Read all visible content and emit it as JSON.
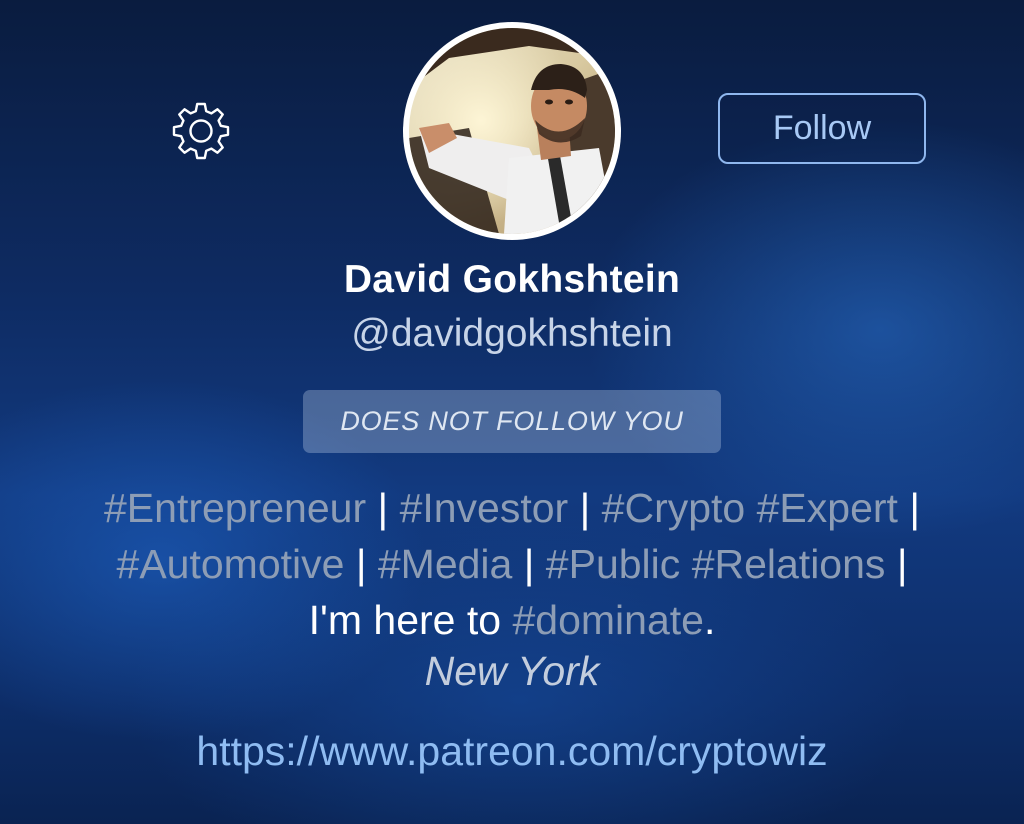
{
  "profile": {
    "name": "David Gokhshtein",
    "handle": "@davidgokhshtein",
    "relationship_badge": "DOES NOT FOLLOW YOU",
    "location": "New York",
    "website": "https://www.patreon.com/cryptowiz",
    "avatar_icon": "profile-photo"
  },
  "actions": {
    "follow_label": "Follow",
    "settings_icon": "gear-icon"
  },
  "bio": {
    "line1": [
      {
        "text": "#Entrepreneur",
        "kind": "tag"
      },
      {
        "text": " | ",
        "kind": "plain"
      },
      {
        "text": "#Investor",
        "kind": "tag"
      },
      {
        "text": " | ",
        "kind": "plain"
      },
      {
        "text": "#Crypto",
        "kind": "tag"
      },
      {
        "text": " ",
        "kind": "plain"
      },
      {
        "text": "#Expert",
        "kind": "tag"
      },
      {
        "text": " |",
        "kind": "plain"
      }
    ],
    "line2": [
      {
        "text": "#Automotive",
        "kind": "tag"
      },
      {
        "text": " | ",
        "kind": "plain"
      },
      {
        "text": "#Media",
        "kind": "tag"
      },
      {
        "text": " | ",
        "kind": "plain"
      },
      {
        "text": "#Public",
        "kind": "tag"
      },
      {
        "text": " ",
        "kind": "plain"
      },
      {
        "text": "#Relations",
        "kind": "tag"
      },
      {
        "text": " |",
        "kind": "plain"
      }
    ],
    "line3": [
      {
        "text": "I'm here to ",
        "kind": "plain"
      },
      {
        "text": "#dominate",
        "kind": "tag"
      },
      {
        "text": ".",
        "kind": "plain"
      }
    ]
  },
  "colors": {
    "background": "#0e2b62",
    "hashtag": "#8d9db5",
    "link": "#8fbcf2",
    "follow_border": "#8fb7ee"
  }
}
